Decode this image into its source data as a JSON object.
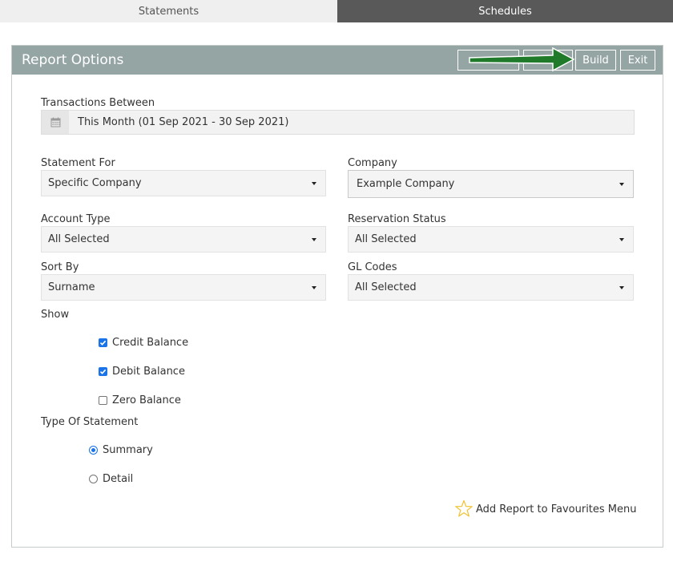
{
  "tabs": {
    "statements": "Statements",
    "schedules": "Schedules"
  },
  "header": {
    "title": "Report Options",
    "build_label": "Build",
    "exit_label": "Exit",
    "arrow_color": "#1f7a2a"
  },
  "form": {
    "transactions_between": {
      "label": "Transactions Between",
      "value": "This Month (01 Sep 2021 - 30 Sep 2021)"
    },
    "statement_for": {
      "label": "Statement For",
      "value": "Specific Company"
    },
    "company": {
      "label": "Company",
      "value": "Example Company"
    },
    "account_type": {
      "label": "Account Type",
      "value": "All Selected"
    },
    "reservation_status": {
      "label": "Reservation Status",
      "value": "All Selected"
    },
    "sort_by": {
      "label": "Sort By",
      "value": "Surname"
    },
    "gl_codes": {
      "label": "GL Codes",
      "value": "All Selected"
    },
    "show": {
      "label": "Show",
      "options": [
        {
          "label": "Credit Balance",
          "checked": true
        },
        {
          "label": "Debit Balance",
          "checked": true
        },
        {
          "label": "Zero Balance",
          "checked": false
        }
      ]
    },
    "type_of_statement": {
      "label": "Type Of Statement",
      "options": [
        {
          "label": "Summary",
          "selected": true
        },
        {
          "label": "Detail",
          "selected": false
        }
      ]
    }
  },
  "favourites": {
    "label": "Add Report to Favourites Menu"
  },
  "colors": {
    "header_bg": "#95a5a4",
    "active_tab_bg": "#595959",
    "checkbox_blue": "#1a73e8"
  }
}
